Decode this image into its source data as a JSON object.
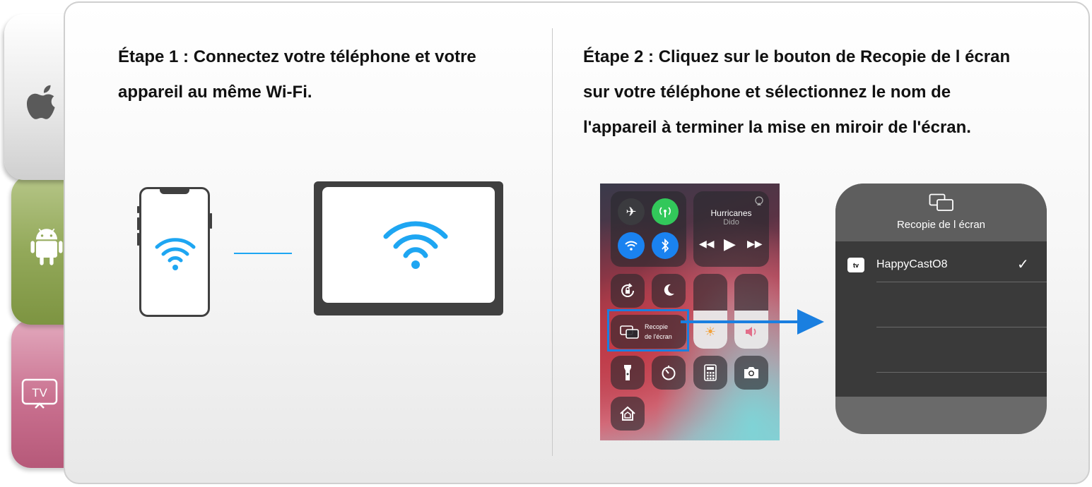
{
  "sidebar": {
    "tabs": [
      {
        "name": "apple-tab",
        "icon": "apple-icon"
      },
      {
        "name": "android-tab",
        "icon": "android-icon"
      },
      {
        "name": "tv-tab",
        "icon": "tv-icon",
        "label": "TV"
      }
    ]
  },
  "step1": {
    "line1": "Étape 1 : Connectez votre téléphone et votre",
    "line2": "appareil au même Wi-Fi."
  },
  "step2": {
    "line1": "Étape 2 : Cliquez sur le bouton de Recopie de l écran",
    "line2": "sur votre téléphone et sélectionnez le nom de",
    "line3": "l'appareil à terminer la mise en miroir de l'écran."
  },
  "control_center": {
    "song_title": "Hurricanes",
    "song_artist": "Dido",
    "mirroring_line1": "Recopie",
    "mirroring_line2": "de l'écran"
  },
  "mirroring_dialog": {
    "title": "Recopie de l écran",
    "device_badge": "tv",
    "device_name": "HappyCastO8",
    "selected_mark": "✓"
  },
  "colors": {
    "accent_blue": "#1a7fe0",
    "wifi_blue": "#1ea6f2",
    "apple_tab": "#e0e0e0",
    "android_tab": "#93a95a",
    "tv_tab": "#c9708f"
  }
}
